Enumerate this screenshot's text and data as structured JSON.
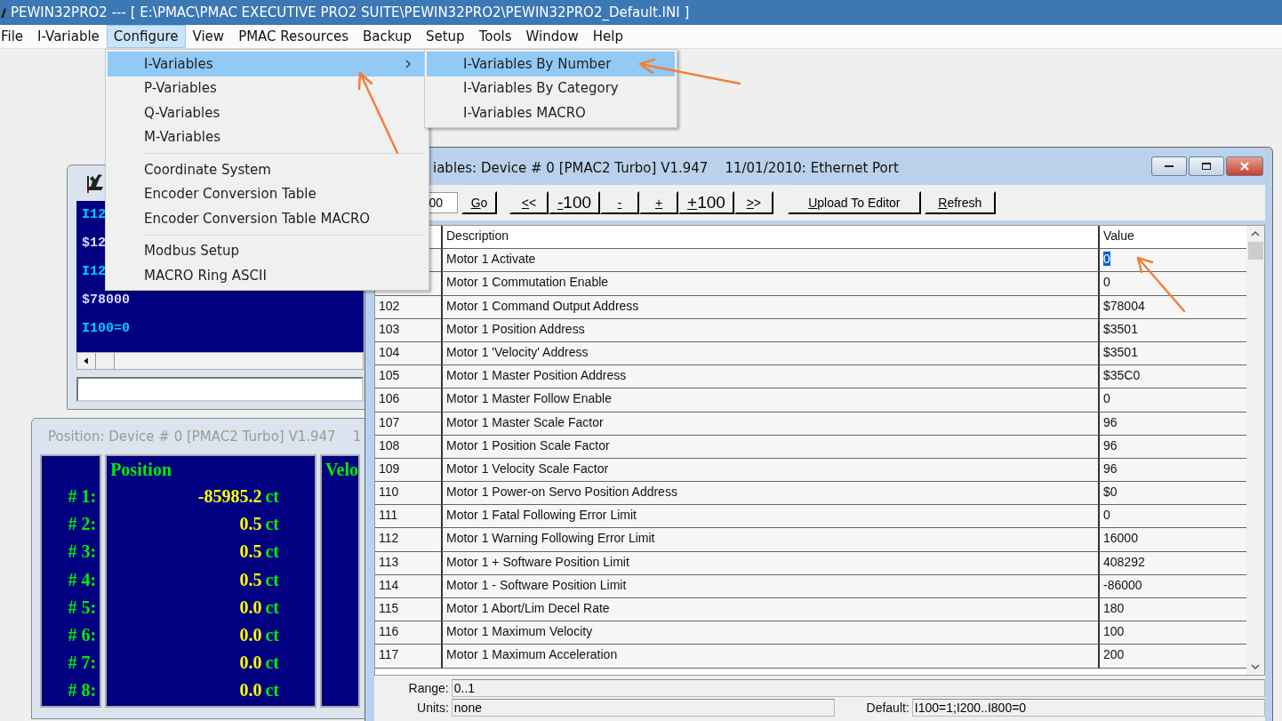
{
  "window": {
    "title": "PEWIN32PRO2 --- [ E:\\PMAC\\PMAC EXECUTIVE PRO2 SUITE\\PEWIN32PRO2\\PEWIN32PRO2_Default.INI ]"
  },
  "menu_bar": [
    {
      "label": "File",
      "selected": false
    },
    {
      "label": "I-Variable",
      "selected": false
    },
    {
      "label": "Configure",
      "selected": true
    },
    {
      "label": "View",
      "selected": false
    },
    {
      "label": "PMAC Resources",
      "selected": false
    },
    {
      "label": "Backup",
      "selected": false
    },
    {
      "label": "Setup",
      "selected": false
    },
    {
      "label": "Tools",
      "selected": false
    },
    {
      "label": "Window",
      "selected": false
    },
    {
      "label": "Help",
      "selected": false
    }
  ],
  "configure_menu": [
    {
      "kind": "item",
      "label": "I-Variables",
      "selected": true,
      "submenu": true
    },
    {
      "kind": "item",
      "label": "P-Variables",
      "selected": false,
      "submenu": false
    },
    {
      "kind": "item",
      "label": "Q-Variables",
      "selected": false,
      "submenu": false
    },
    {
      "kind": "item",
      "label": "M-Variables",
      "selected": false,
      "submenu": false
    },
    {
      "kind": "separator"
    },
    {
      "kind": "item",
      "label": "Coordinate System",
      "selected": false,
      "submenu": false
    },
    {
      "kind": "item",
      "label": "Encoder Conversion Table",
      "selected": false,
      "submenu": false
    },
    {
      "kind": "item",
      "label": "Encoder Conversion Table MACRO",
      "selected": false,
      "submenu": false
    },
    {
      "kind": "separator"
    },
    {
      "kind": "item",
      "label": "Modbus Setup",
      "selected": false,
      "submenu": false
    },
    {
      "kind": "item",
      "label": "MACRO Ring ASCII",
      "selected": false,
      "submenu": false
    }
  ],
  "submenu": [
    {
      "label": "I-Variables By Number",
      "selected": true
    },
    {
      "label": "I-Variables By Category",
      "selected": false
    },
    {
      "label": "I-Variables MACRO",
      "selected": false
    }
  ],
  "terminal_window": {
    "lines": [
      {
        "kind": "command",
        "text": "I12"
      },
      {
        "kind": "response",
        "text": "$12"
      },
      {
        "kind": "command",
        "text": "I12"
      },
      {
        "kind": "response",
        "text": "$78000"
      },
      {
        "kind": "command",
        "text": "I100=0"
      }
    ]
  },
  "position_window": {
    "title": "Position: Device # 0 [PMAC2 Turbo] V1.947    1",
    "position_header": "Position",
    "column_3_header": "Velo",
    "rows": [
      {
        "label": "# 1:",
        "value": "-85985.2",
        "unit": "ct"
      },
      {
        "label": "# 2:",
        "value": "0.5",
        "unit": "ct"
      },
      {
        "label": "# 3:",
        "value": "0.5",
        "unit": "ct"
      },
      {
        "label": "# 4:",
        "value": "0.5",
        "unit": "ct"
      },
      {
        "label": "# 5:",
        "value": "0.0",
        "unit": "ct"
      },
      {
        "label": "# 6:",
        "value": "0.0",
        "unit": "ct"
      },
      {
        "label": "# 7:",
        "value": "0.0",
        "unit": "ct"
      },
      {
        "label": "# 8:",
        "value": "0.0",
        "unit": "ct"
      }
    ]
  },
  "ivar_window": {
    "title": "iables: Device # 0 [PMAC2 Turbo] V1.947    11/01/2010: Ethernet Port",
    "number_field": "00",
    "buttons": [
      "Go",
      "<<",
      "-100",
      "-",
      "+",
      "+100",
      ">>",
      "Upload To Editor",
      "Refresh"
    ],
    "columns": [
      "Description",
      "Value"
    ],
    "rows": [
      {
        "description": "Motor 1 Activate",
        "value": "0",
        "selected": true
      },
      {
        "description": "Motor 1 Commutation Enable",
        "value": "0",
        "selected": false
      },
      {
        "number": "102",
        "description": "Motor 1 Command Output Address",
        "value": "$78004",
        "selected": false
      },
      {
        "number": "103",
        "description": "Motor 1 Position Address",
        "value": "$3501",
        "selected": false
      },
      {
        "number": "104",
        "description": "Motor 1 'Velocity' Address",
        "value": "$3501",
        "selected": false
      },
      {
        "number": "105",
        "description": "Motor 1 Master Position Address",
        "value": "$35C0",
        "selected": false
      },
      {
        "number": "106",
        "description": "Motor 1 Master Follow Enable",
        "value": "0",
        "selected": false
      },
      {
        "number": "107",
        "description": "Motor 1 Master Scale Factor",
        "value": "96",
        "selected": false
      },
      {
        "number": "108",
        "description": "Motor 1 Position Scale Factor",
        "value": "96",
        "selected": false
      },
      {
        "number": "109",
        "description": "Motor 1 Velocity Scale Factor",
        "value": "96",
        "selected": false
      },
      {
        "number": "110",
        "description": "Motor 1 Power-on Servo Position Address",
        "value": "$0",
        "selected": false
      },
      {
        "number": "111",
        "description": "Motor 1 Fatal Following Error Limit",
        "value": "0",
        "selected": false
      },
      {
        "number": "112",
        "description": "Motor 1 Warning Following Error Limit",
        "value": "16000",
        "selected": false
      },
      {
        "number": "113",
        "description": "Motor 1 + Software Position Limit",
        "value": "408292",
        "selected": false
      },
      {
        "number": "114",
        "description": "Motor 1 - Software Position Limit",
        "value": "-86000",
        "selected": false
      },
      {
        "number": "115",
        "description": "Motor 1 Abort/Lim Decel Rate",
        "value": "180",
        "selected": false
      },
      {
        "number": "116",
        "description": "Motor 1 Maximum Velocity",
        "value": "100",
        "selected": false
      },
      {
        "number": "117",
        "description": "Motor 1 Maximum Acceleration",
        "value": "200",
        "selected": false
      }
    ],
    "range": {
      "label": "Range:",
      "value": "0..1"
    },
    "units": {
      "label": "Units:",
      "value": "none"
    },
    "default": {
      "label": "Default:",
      "value": "I100=1;I200..I800=0"
    }
  }
}
